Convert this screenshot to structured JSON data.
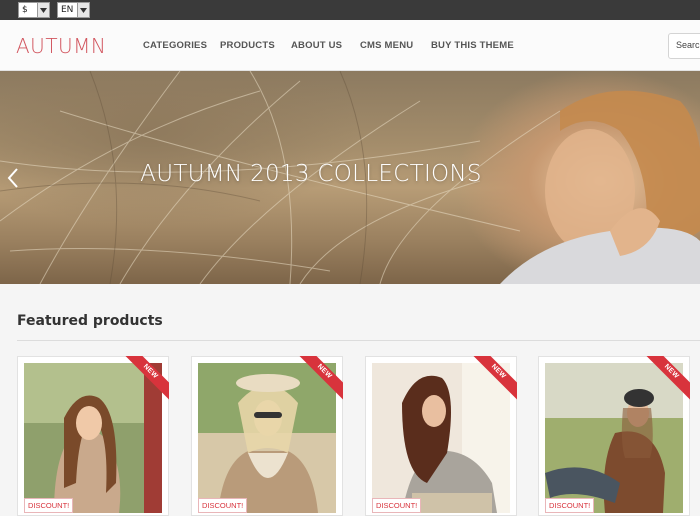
{
  "topbar": {
    "currency": "$",
    "language": "EN"
  },
  "header": {
    "logo": "AUTUMN",
    "nav": [
      "CATEGORIES",
      "PRODUCTS",
      "ABOUT US",
      "CMS MENU",
      "BUY THIS THEME"
    ],
    "search_placeholder": "Search"
  },
  "hero": {
    "title": "AUTUMN 2013 COLLECTIONS"
  },
  "featured": {
    "title": "Featured products",
    "products": [
      {
        "badge": "NEW",
        "tag": "DISCOUNT!"
      },
      {
        "badge": "NEW",
        "tag": "DISCOUNT!"
      },
      {
        "badge": "NEW",
        "tag": "DISCOUNT!"
      },
      {
        "badge": "NEW",
        "tag": "DISCOUNT!"
      }
    ]
  },
  "colors": {
    "brand": "#d2565f",
    "ribbon": "#d8333c",
    "topbar": "#3a3a3a"
  }
}
